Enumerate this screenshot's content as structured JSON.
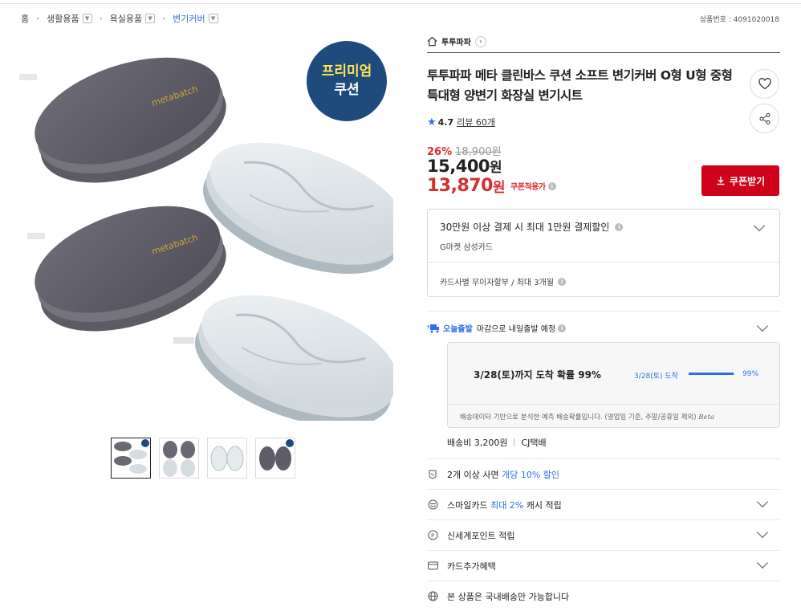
{
  "breadcrumb": {
    "home": "홈",
    "cat1": "생활용품",
    "cat2": "욕실용품",
    "cat3": "변기커버"
  },
  "product_no": "상품번호 : 4091020018",
  "gallery": {
    "badge_line1": "프리미엄",
    "badge_line2": "쿠션",
    "seat_brand_text": "metabatch",
    "thumbnails": 4,
    "selected_thumbnail": 1
  },
  "shop": {
    "name": "투투파파"
  },
  "title": "투투파파 메타 클린바스 쿠션 소프트 변기커버 O형 U형 중형 특대형 양변기 화장실 변기시트",
  "rating": {
    "score": "4.7",
    "reviews": "리뷰 60개"
  },
  "pricing": {
    "discount": "26%",
    "original": "18,900원",
    "price": "15,400",
    "price_unit": "원",
    "coupon_price": "13,870",
    "coupon_unit": "원",
    "coupon_label": "쿠폰적용가",
    "coupon_button": "쿠폰받기"
  },
  "card_benefit": {
    "title": "30만원 이상 결제 시 최대 1만원 결제할인",
    "card": "G마켓 삼성카드",
    "installment": "카드사별 무이자할부 / 최대 3개월"
  },
  "shipping": {
    "label": "오늘출발",
    "text": "마감으로 내일출발 예정",
    "predict_big": "3/28(토)까지 도착 확률 99%",
    "predict_small": "3/28(토) 도착",
    "predict_pct": "99%",
    "predict_fraction": 0.99,
    "note": "배송데이터 기반으로 분석한 예측 배송확률입니다. (영업일 기준, 주말/공휴일 제외)",
    "beta": "Beta",
    "fee": "배송비 3,200원",
    "carrier": "CJ택배"
  },
  "benefits": {
    "multi_prefix": "2개 이상 사면",
    "multi_highlight": "개당 10% 할인",
    "smile_prefix": "스마일카드",
    "smile_highlight": "최대 2%",
    "smile_suffix": "캐시 적립",
    "shinsegae": "신세계포인트 적립",
    "card_extra": "카드추가혜택",
    "domestic": "본 상품은 국내배송만 가능합니다"
  },
  "colors": {
    "accent_red": "#d0021b",
    "price_red": "#d32f2f",
    "blue": "#2f6ee8",
    "badge_navy": "#1e4b7b",
    "badge_yellow": "#fde25c"
  }
}
